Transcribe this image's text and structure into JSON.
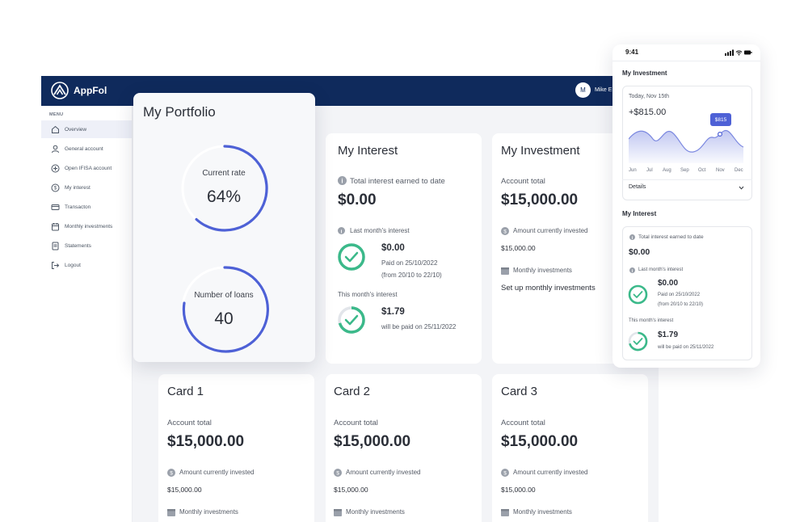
{
  "app": {
    "name": "AppFol",
    "user_initial": "M",
    "user_name": "Mike E"
  },
  "sidebar": {
    "menu_label": "MENU",
    "items": [
      {
        "label": "Overview",
        "icon": "home-icon"
      },
      {
        "label": "General account",
        "icon": "user-icon"
      },
      {
        "label": "Open IFISA account",
        "icon": "plus-circle-icon"
      },
      {
        "label": "My interest",
        "icon": "dollar-circle-icon"
      },
      {
        "label": "Transacton",
        "icon": "card-icon"
      },
      {
        "label": "Monthly investments",
        "icon": "calendar-icon"
      },
      {
        "label": "Statements",
        "icon": "document-icon"
      },
      {
        "label": "Logout",
        "icon": "logout-icon"
      }
    ]
  },
  "portfolio": {
    "title": "My Portfolio",
    "rate_label": "Current rate",
    "rate_value": "64%",
    "loans_label": "Number of loans",
    "loans_value": "40"
  },
  "interest": {
    "title": "My Interest",
    "total_label": "Total interest earned to date",
    "total_value": "$0.00",
    "last_label": "Last month's interest",
    "last_value": "$0.00",
    "last_paid": "Paid on 25/10/2022",
    "last_range": "(from 20/10 to 22/10)",
    "this_label": "This month's interest",
    "this_value": "$1.79",
    "this_paid": "will be paid on 25/11/2022"
  },
  "investment": {
    "title": "My Investment",
    "account_label": "Account total",
    "account_value": "$15,000.00",
    "invested_label": "Amount currently invested",
    "invested_value": "$15,000.00",
    "monthly_label": "Monthly investments",
    "setup_label": "Set up monthly investments"
  },
  "cards": [
    {
      "title": "Card 1",
      "account_label": "Account total",
      "account_value": "$15,000.00",
      "invested_label": "Amount currently invested",
      "invested_value": "$15,000.00",
      "monthly_label": "Monthly investments"
    },
    {
      "title": "Card 2",
      "account_label": "Account total",
      "account_value": "$15,000.00",
      "invested_label": "Amount currently invested",
      "invested_value": "$15,000.00",
      "monthly_label": "Monthly investments"
    },
    {
      "title": "Card 3",
      "account_label": "Account total",
      "account_value": "$15,000.00",
      "invested_label": "Amount currently invested",
      "invested_value": "$15,000.00",
      "monthly_label": "Monthly investments"
    }
  ],
  "phone": {
    "time": "9:41",
    "investment_heading": "My Investment",
    "date": "Today, Nov 15th",
    "gain": "+$815.00",
    "tooltip": "$815",
    "months": [
      "Jun",
      "Jul",
      "Aug",
      "Sep",
      "Oct",
      "Nov",
      "Dec"
    ],
    "details_label": "Details",
    "interest_heading": "My Interest",
    "total_label": "Total interest earned to date",
    "total_value": "$0.00",
    "last_label": "Last month's interest",
    "last_value": "$0.00",
    "last_paid": "Paid on 25/10/2022",
    "last_range": "(from 20/10 to 22/10)",
    "this_label": "This month's interest",
    "this_value": "$1.79",
    "this_paid": "will be paid on 25/11/2022"
  },
  "colors": {
    "navy": "#0f2a5c",
    "accent": "#4e61d6",
    "success": "#3bb98a"
  }
}
